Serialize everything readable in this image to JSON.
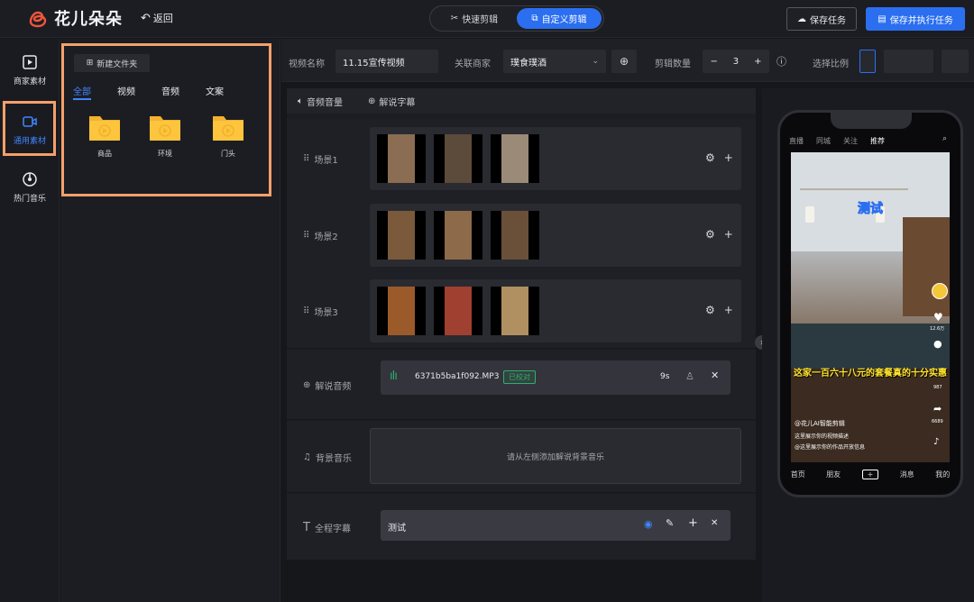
{
  "app": {
    "name": "花儿朵朵",
    "back_label": "返回"
  },
  "modes": [
    {
      "label": "快速剪辑",
      "icon": "scissors-icon",
      "active": false
    },
    {
      "label": "自定义剪辑",
      "icon": "crop-icon",
      "active": true
    }
  ],
  "actions": {
    "save": "保存任务",
    "save_run": "保存并执行任务"
  },
  "rail": [
    {
      "label": "商家素材",
      "icon": "video-square-icon",
      "active": false
    },
    {
      "label": "通用素材",
      "icon": "camera-icon",
      "active": true
    },
    {
      "label": "热门音乐",
      "icon": "disc-icon",
      "active": false
    }
  ],
  "materials": {
    "new_folder": "新建文件夹",
    "tabs": [
      "全部",
      "视频",
      "音频",
      "文案"
    ],
    "active_tab": "全部",
    "folders": [
      "商品",
      "环境",
      "门头"
    ]
  },
  "settings": {
    "video_name_label": "视频名称",
    "video_name_value": "11.15宣传视频",
    "merchant_label": "关联商家",
    "merchant_value": "璞食璞酒",
    "cut_count_label": "剪辑数量",
    "cut_count_value": "3",
    "ratio_label": "选择比例"
  },
  "tools": {
    "volume": "音频音量",
    "subtitle": "解说字幕"
  },
  "scenes": [
    {
      "label": "场景1",
      "thumb_colors": [
        "#8a6d52",
        "#5c4a3a",
        "#9b8a78"
      ]
    },
    {
      "label": "场景2",
      "thumb_colors": [
        "#7a5a3a",
        "#8c6a4a",
        "#6a5038"
      ]
    },
    {
      "label": "场景3",
      "thumb_colors": [
        "#9a5a2a",
        "#a04030",
        "#b09060"
      ]
    }
  ],
  "narration": {
    "label": "解说音频",
    "file": "6371b5ba1f092.MP3",
    "badge": "已校对",
    "duration": "9s"
  },
  "bgm": {
    "label": "背景音乐",
    "placeholder": "请从左侧添加解说背景音乐"
  },
  "caption": {
    "label": "全程字幕",
    "value": "测试"
  },
  "phone": {
    "top_tabs": [
      "直播",
      "同城",
      "关注",
      "推荐"
    ],
    "title_text": "测试",
    "overlay_text": "这家一百六十八元的套餐真的十分实惠",
    "user": "@花儿AI智能剪辑",
    "desc1": "这里展示你的视频描述",
    "desc2": "@这里展示你的作品开放信息",
    "likes": "12.6万",
    "comments": "987",
    "shares": "6689",
    "bottom_nav": [
      "首页",
      "朋友",
      "+",
      "消息",
      "我的"
    ]
  },
  "colors": {
    "accent": "#2b6ff0",
    "highlight": "#f4a06a",
    "badge": "#2fae6b"
  }
}
